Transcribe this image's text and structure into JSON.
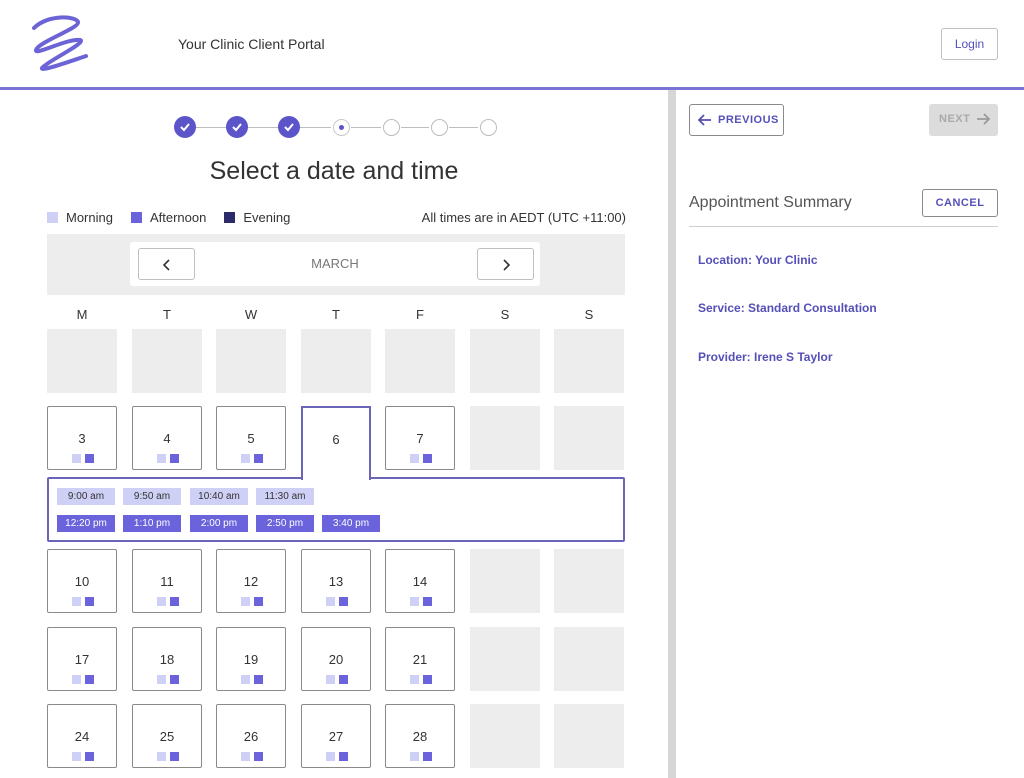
{
  "header": {
    "portal_title": "Your Clinic Client Portal",
    "login_label": "Login",
    "accent_color": "#7a72d4"
  },
  "stepper": {
    "total_steps": 7,
    "completed_steps": 3,
    "current_step": 4
  },
  "page_heading": "Select a date and time",
  "legend": {
    "morning": "Morning",
    "afternoon": "Afternoon",
    "evening": "Evening",
    "colors": {
      "morning": "#cfd0f5",
      "afternoon": "#6a63dc",
      "evening": "#2b2a6b"
    }
  },
  "timezone_note": "All times are in AEDT (UTC +11:00)",
  "month_nav": {
    "month": "MARCH",
    "prev_icon": "chevron-left-icon",
    "next_icon": "chevron-right-icon"
  },
  "weekdays": [
    "M",
    "T",
    "W",
    "T",
    "F",
    "S",
    "S"
  ],
  "weeks": [
    [
      null,
      null,
      null,
      null,
      null,
      null,
      null
    ],
    [
      "3",
      "4",
      "5",
      "6",
      "7",
      null,
      null
    ],
    [
      "10",
      "11",
      "12",
      "13",
      "14",
      null,
      null
    ],
    [
      "17",
      "18",
      "19",
      "20",
      "21",
      null,
      null
    ],
    [
      "24",
      "25",
      "26",
      "27",
      "28",
      null,
      null
    ]
  ],
  "selected_day": "6",
  "time_slots": {
    "morning": [
      "9:00 am",
      "9:50 am",
      "10:40 am",
      "11:30 am"
    ],
    "afternoon": [
      "12:20 pm",
      "1:10 pm",
      "2:00 pm",
      "2:50 pm",
      "3:40 pm"
    ]
  },
  "nav": {
    "previous_label": "PREVIOUS",
    "next_label": "NEXT"
  },
  "summary": {
    "title": "Appointment Summary",
    "cancel_label": "CANCEL",
    "location": "Location: Your Clinic",
    "service": "Service: Standard Consultation",
    "provider": "Provider: Irene S Taylor"
  }
}
